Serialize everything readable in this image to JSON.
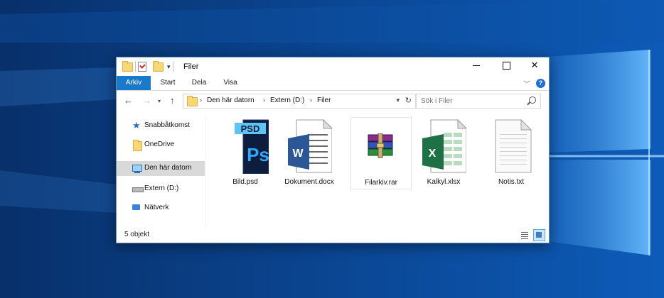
{
  "window": {
    "title": "Filer",
    "min_symbol": "—",
    "max_symbol": "☐",
    "close_symbol": "✕"
  },
  "ribbon": {
    "tabs": [
      "Arkiv",
      "Start",
      "Dela",
      "Visa"
    ],
    "help_label": "?"
  },
  "navigation": {
    "back": "←",
    "forward": "→",
    "up": "↑",
    "breadcrumbs": [
      "Den här datorn",
      "Extern (D:)",
      "Filer"
    ],
    "search_placeholder": "Sök i Filer"
  },
  "sidebar": {
    "items": [
      {
        "label": "Snabbåtkomst",
        "icon": "star-icon"
      },
      {
        "label": "OneDrive",
        "icon": "folder-icon"
      },
      {
        "label": "Den här datorn",
        "icon": "computer-icon",
        "selected": true
      },
      {
        "label": "Extern (D:)",
        "icon": "drive-icon"
      },
      {
        "label": "Nätverk",
        "icon": "network-icon"
      }
    ]
  },
  "files": [
    {
      "name": "Bild.psd",
      "icon": "photoshop-file-icon",
      "badge": "PSD",
      "mark": "Ps"
    },
    {
      "name": "Dokument.docx",
      "icon": "word-document-icon",
      "mark": "W"
    },
    {
      "name": "Filarkiv.rar",
      "icon": "rar-archive-icon",
      "selected": true
    },
    {
      "name": "Kalkyl.xlsx",
      "icon": "excel-spreadsheet-icon",
      "mark": "X"
    },
    {
      "name": "Notis.txt",
      "icon": "text-file-icon"
    }
  ],
  "status": {
    "count": "5 objekt"
  },
  "colors": {
    "accent": "#1979ca",
    "desktop": "#0a3a78",
    "selection": "#d9d9d9"
  }
}
